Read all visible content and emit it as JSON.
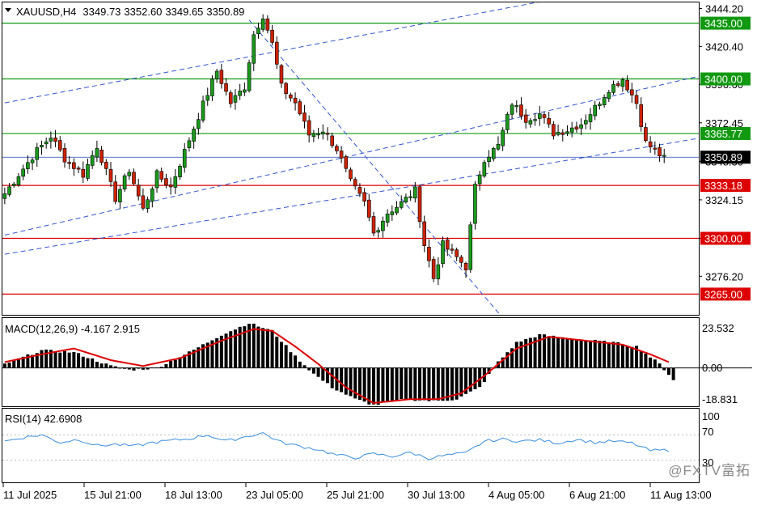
{
  "header": {
    "symbol": "XAUUSD,H4",
    "open": "3349.73",
    "high": "3352.60",
    "low": "3349.65",
    "close": "3350.89"
  },
  "macd_panel": {
    "label": "MACD(12,26,9) -4.167 2.915",
    "scale": [
      "23.532",
      "0.00",
      "-18.831"
    ]
  },
  "rsi_panel": {
    "label": "RSI(14) 42.6908",
    "scale": [
      "100",
      "70",
      "30"
    ]
  },
  "watermark": "@FXTV富拓",
  "colors": {
    "bull": "#1a9a1a",
    "bear": "#cc2200",
    "support_line": "#dd0000",
    "resistance_line": "#119911",
    "trend_line": "#3355cc",
    "signal_line": "#dd0000",
    "rsi_line": "#3a8fdd",
    "histogram": "#000000",
    "price_line": "#2244bb"
  },
  "chart_data": {
    "type": "candlestick",
    "symbol": "XAUUSD",
    "timeframe": "H4",
    "price_axis": {
      "min": 3252,
      "max": 3448,
      "ticks": [
        3444.2,
        3420.4,
        3396.6,
        3372.45,
        3348.3,
        3324.15,
        3300.0,
        3276.2
      ]
    },
    "x_tick_labels": [
      "11 Jul 2025",
      "15 Jul 21:00",
      "18 Jul 13:00",
      "23 Jul 05:00",
      "25 Jul 21:00",
      "30 Jul 13:00",
      "4 Aug 05:00",
      "6 Aug 21:00",
      "11 Aug 13:00"
    ],
    "horizontal_levels": [
      {
        "label": "3435.00",
        "value": 3435.0,
        "kind": "resistance"
      },
      {
        "label": "3400.00",
        "value": 3400.0,
        "kind": "resistance"
      },
      {
        "label": "3365.77",
        "value": 3365.77,
        "kind": "resistance"
      },
      {
        "label": "3350.89",
        "value": 3350.89,
        "kind": "current"
      },
      {
        "label": "3333.18",
        "value": 3333.18,
        "kind": "support"
      },
      {
        "label": "3300.00",
        "value": 3300.0,
        "kind": "support"
      },
      {
        "label": "3265.00",
        "value": 3265.0,
        "kind": "support"
      }
    ],
    "candle_close_path": [
      [
        0,
        3328
      ],
      [
        3,
        3340
      ],
      [
        7,
        3355
      ],
      [
        10,
        3364
      ],
      [
        13,
        3350
      ],
      [
        17,
        3340
      ],
      [
        20,
        3358
      ],
      [
        24,
        3325
      ],
      [
        27,
        3343
      ],
      [
        30,
        3318
      ],
      [
        33,
        3340
      ],
      [
        36,
        3332
      ],
      [
        40,
        3362
      ],
      [
        43,
        3384
      ],
      [
        46,
        3405
      ],
      [
        49,
        3385
      ],
      [
        52,
        3395
      ],
      [
        54,
        3428
      ],
      [
        56,
        3440
      ],
      [
        58,
        3422
      ],
      [
        60,
        3395
      ],
      [
        63,
        3385
      ],
      [
        66,
        3365
      ],
      [
        69,
        3368
      ],
      [
        72,
        3356
      ],
      [
        75,
        3335
      ],
      [
        78,
        3322
      ],
      [
        80,
        3303
      ],
      [
        83,
        3316
      ],
      [
        86,
        3322
      ],
      [
        89,
        3330
      ],
      [
        91,
        3296
      ],
      [
        93,
        3275
      ],
      [
        95,
        3296
      ],
      [
        98,
        3288
      ],
      [
        100,
        3282
      ],
      [
        102,
        3332
      ],
      [
        104,
        3350
      ],
      [
        107,
        3358
      ],
      [
        110,
        3385
      ],
      [
        113,
        3375
      ],
      [
        116,
        3378
      ],
      [
        119,
        3366
      ],
      [
        122,
        3368
      ],
      [
        125,
        3372
      ],
      [
        128,
        3382
      ],
      [
        131,
        3394
      ],
      [
        134,
        3400
      ],
      [
        137,
        3385
      ],
      [
        139,
        3360
      ],
      [
        141,
        3355
      ],
      [
        143,
        3350
      ]
    ],
    "trend_lines": [
      {
        "from": [
          0,
          3385
        ],
        "to": [
          119,
          3450
        ]
      },
      {
        "from": [
          0,
          3290
        ],
        "to": [
          151,
          3363
        ]
      },
      {
        "from": [
          0,
          3302
        ],
        "to": [
          151,
          3402
        ]
      },
      {
        "from": [
          53,
          3437
        ],
        "to": [
          108,
          3250
        ]
      }
    ],
    "macd": {
      "range": [
        -18.831,
        23.532
      ],
      "histogram_path": [
        [
          0,
          2
        ],
        [
          8,
          9
        ],
        [
          15,
          8
        ],
        [
          23,
          1
        ],
        [
          27,
          -1
        ],
        [
          33,
          0
        ],
        [
          40,
          8
        ],
        [
          47,
          17
        ],
        [
          53,
          23
        ],
        [
          58,
          19
        ],
        [
          63,
          6
        ],
        [
          67,
          -3
        ],
        [
          71,
          -10
        ],
        [
          76,
          -16
        ],
        [
          80,
          -19
        ],
        [
          87,
          -16
        ],
        [
          93,
          -17
        ],
        [
          98,
          -16
        ],
        [
          103,
          -10
        ],
        [
          107,
          3
        ],
        [
          111,
          13
        ],
        [
          116,
          17
        ],
        [
          123,
          15
        ],
        [
          132,
          13
        ],
        [
          137,
          11
        ],
        [
          142,
          2
        ],
        [
          145,
          -6
        ]
      ],
      "signal_path": [
        [
          0,
          3
        ],
        [
          8,
          7
        ],
        [
          15,
          10
        ],
        [
          23,
          4
        ],
        [
          30,
          1
        ],
        [
          38,
          5
        ],
        [
          47,
          14
        ],
        [
          54,
          20
        ],
        [
          58,
          19
        ],
        [
          63,
          11
        ],
        [
          68,
          2
        ],
        [
          74,
          -10
        ],
        [
          80,
          -18
        ],
        [
          88,
          -16
        ],
        [
          94,
          -16
        ],
        [
          99,
          -13
        ],
        [
          104,
          -4
        ],
        [
          111,
          10
        ],
        [
          118,
          16
        ],
        [
          126,
          14
        ],
        [
          134,
          12
        ],
        [
          140,
          7
        ],
        [
          144,
          3
        ]
      ]
    },
    "rsi": {
      "range": [
        0,
        100
      ],
      "levels": [
        70,
        30
      ],
      "path": [
        [
          0,
          60
        ],
        [
          4,
          66
        ],
        [
          8,
          70
        ],
        [
          12,
          58
        ],
        [
          16,
          63
        ],
        [
          20,
          53
        ],
        [
          24,
          55
        ],
        [
          28,
          52
        ],
        [
          32,
          58
        ],
        [
          36,
          61
        ],
        [
          40,
          64
        ],
        [
          44,
          70
        ],
        [
          48,
          60
        ],
        [
          52,
          67
        ],
        [
          56,
          73
        ],
        [
          60,
          58
        ],
        [
          64,
          52
        ],
        [
          68,
          47
        ],
        [
          72,
          38
        ],
        [
          76,
          34
        ],
        [
          80,
          40
        ],
        [
          84,
          36
        ],
        [
          88,
          42
        ],
        [
          92,
          33
        ],
        [
          96,
          38
        ],
        [
          100,
          41
        ],
        [
          104,
          60
        ],
        [
          108,
          63
        ],
        [
          112,
          60
        ],
        [
          116,
          62
        ],
        [
          120,
          57
        ],
        [
          124,
          63
        ],
        [
          128,
          58
        ],
        [
          132,
          60
        ],
        [
          136,
          57
        ],
        [
          140,
          45
        ],
        [
          144,
          46
        ]
      ]
    }
  }
}
